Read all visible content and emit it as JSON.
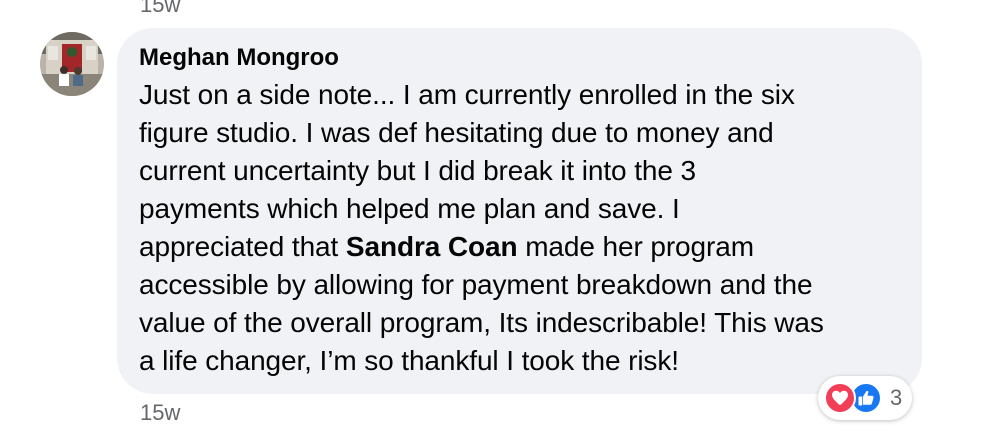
{
  "previous_comment": {
    "timestamp": "15w"
  },
  "comment": {
    "author": "Meghan Mongroo",
    "text_before_mention": "Just on a side note... I am currently enrolled in the six\nfigure studio. I was def hesitating due to money and\ncurrent uncertainty but I did break it into the 3\npayments which helped me plan and save. I\nappreciated that ",
    "mention": "Sandra Coan",
    "text_after_mention": " made her program\naccessible by allowing for payment breakdown and the\nvalue of the overall program, Its indescribable! This was\na life changer, I’m so thankful I took the risk!",
    "timestamp": "15w",
    "reactions": {
      "icons": [
        "love-icon",
        "like-icon"
      ],
      "count": "3"
    }
  },
  "colors": {
    "bubble_bg": "#f0f2f5",
    "text": "#050505",
    "meta": "#65676b",
    "love": "#f33e58",
    "like": "#1877f2"
  }
}
